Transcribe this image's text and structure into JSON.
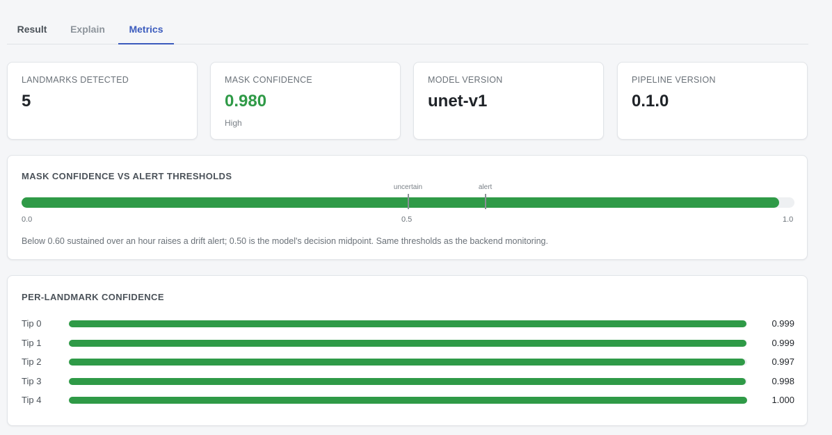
{
  "tabs": [
    {
      "label": "Result",
      "active": false
    },
    {
      "label": "Explain",
      "active": false
    },
    {
      "label": "Metrics",
      "active": true
    }
  ],
  "stats": [
    {
      "label": "LANDMARKS DETECTED",
      "value": "5"
    },
    {
      "label": "MASK CONFIDENCE",
      "value": "0.980",
      "sub": "High",
      "color": "#2f9a47"
    },
    {
      "label": "MODEL VERSION",
      "value": "unet-v1"
    },
    {
      "label": "PIPELINE VERSION",
      "value": "0.1.0"
    }
  ],
  "thresholds": {
    "title": "MASK CONFIDENCE VS ALERT THRESHOLDS",
    "confidence": 0.98,
    "markers": [
      {
        "label": "uncertain",
        "value": 0.5
      },
      {
        "label": "alert",
        "value": 0.6
      }
    ],
    "ticks": [
      "0.0",
      "0.5",
      "1.0"
    ],
    "note": "Below 0.60 sustained over an hour raises a drift alert; 0.50 is the model's decision midpoint. Same thresholds as the backend monitoring."
  },
  "landmarks": {
    "title": "PER-LANDMARK CONFIDENCE",
    "items": [
      {
        "name": "Tip 0",
        "value": "0.999",
        "fraction": 0.999
      },
      {
        "name": "Tip 1",
        "value": "0.999",
        "fraction": 0.999
      },
      {
        "name": "Tip 2",
        "value": "0.997",
        "fraction": 0.997
      },
      {
        "name": "Tip 3",
        "value": "0.998",
        "fraction": 0.998
      },
      {
        "name": "Tip 4",
        "value": "1.000",
        "fraction": 1.0
      }
    ]
  },
  "colors": {
    "accent": "#3b5bbd",
    "success": "#2f9a47",
    "track": "#eef0f2"
  }
}
